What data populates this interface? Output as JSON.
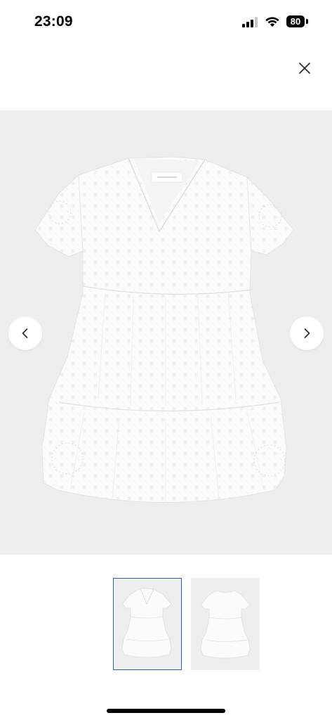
{
  "status_bar": {
    "time": "23:09",
    "battery_level": "80",
    "icons": [
      "signal-icon",
      "wifi-icon",
      "battery-icon"
    ]
  },
  "header": {
    "close_icon": "close-icon"
  },
  "gallery": {
    "current_image_index": 1,
    "total_images": 2,
    "prev_icon": "chevron-left-icon",
    "next_icon": "chevron-right-icon",
    "thumbnails": [
      {
        "selected": true
      },
      {
        "selected": false
      }
    ],
    "colors": {
      "background": "#eeeeee",
      "selected_border": "#2f5fb0",
      "garment": "#fbfbfa"
    }
  }
}
